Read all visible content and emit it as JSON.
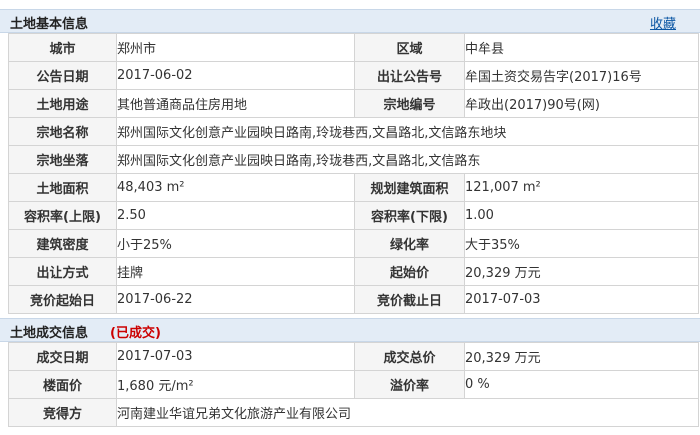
{
  "basic": {
    "title": "土地基本信息",
    "favorite_label": "收藏",
    "rows": [
      {
        "l1": "城市",
        "v1": "郑州市",
        "l2": "区域",
        "v2": "中牟县"
      },
      {
        "l1": "公告日期",
        "v1": "2017-06-02",
        "l2": "出让公告号",
        "v2": "牟国土资交易告字(2017)16号"
      },
      {
        "l1": "土地用途",
        "v1": "其他普通商品住房用地",
        "l2": "宗地编号",
        "v2": "牟政出(2017)90号(网)"
      },
      {
        "l1": "宗地名称",
        "v": "郑州国际文化创意产业园映日路南,玲珑巷西,文昌路北,文信路东地块"
      },
      {
        "l1": "宗地坐落",
        "v": "郑州国际文化创意产业园映日路南,玲珑巷西,文昌路北,文信路东"
      },
      {
        "l1": "土地面积",
        "v1": "48,403 m²",
        "l2": "规划建筑面积",
        "v2": "121,007 m²"
      },
      {
        "l1": "容积率(上限)",
        "v1": "2.50",
        "l2": "容积率(下限)",
        "v2": "1.00"
      },
      {
        "l1": "建筑密度",
        "v1": "小于25%",
        "l2": "绿化率",
        "v2": "大于35%"
      },
      {
        "l1": "出让方式",
        "v1": "挂牌",
        "l2": "起始价",
        "v2": "20,329 万元"
      },
      {
        "l1": "竞价起始日",
        "v1": "2017-06-22",
        "l2": "竞价截止日",
        "v2": "2017-07-03"
      }
    ]
  },
  "deal": {
    "title": "土地成交信息",
    "status": "(已成交)",
    "rows": [
      {
        "l1": "成交日期",
        "v1": "2017-07-03",
        "l2": "成交总价",
        "v2": "20,329 万元"
      },
      {
        "l1": "楼面价",
        "v1": "1,680 元/m²",
        "l2": "溢价率",
        "v2": "0 %"
      },
      {
        "l1": "竞得方",
        "v": "河南建业华谊兄弟文化旅游产业有限公司"
      }
    ]
  },
  "colors": {
    "header_bg": "#e3ecf6",
    "label_bg": "#f5f5f5",
    "link": "#0b56a4",
    "status_red": "#cc0000",
    "border": "#d4d4d4"
  }
}
